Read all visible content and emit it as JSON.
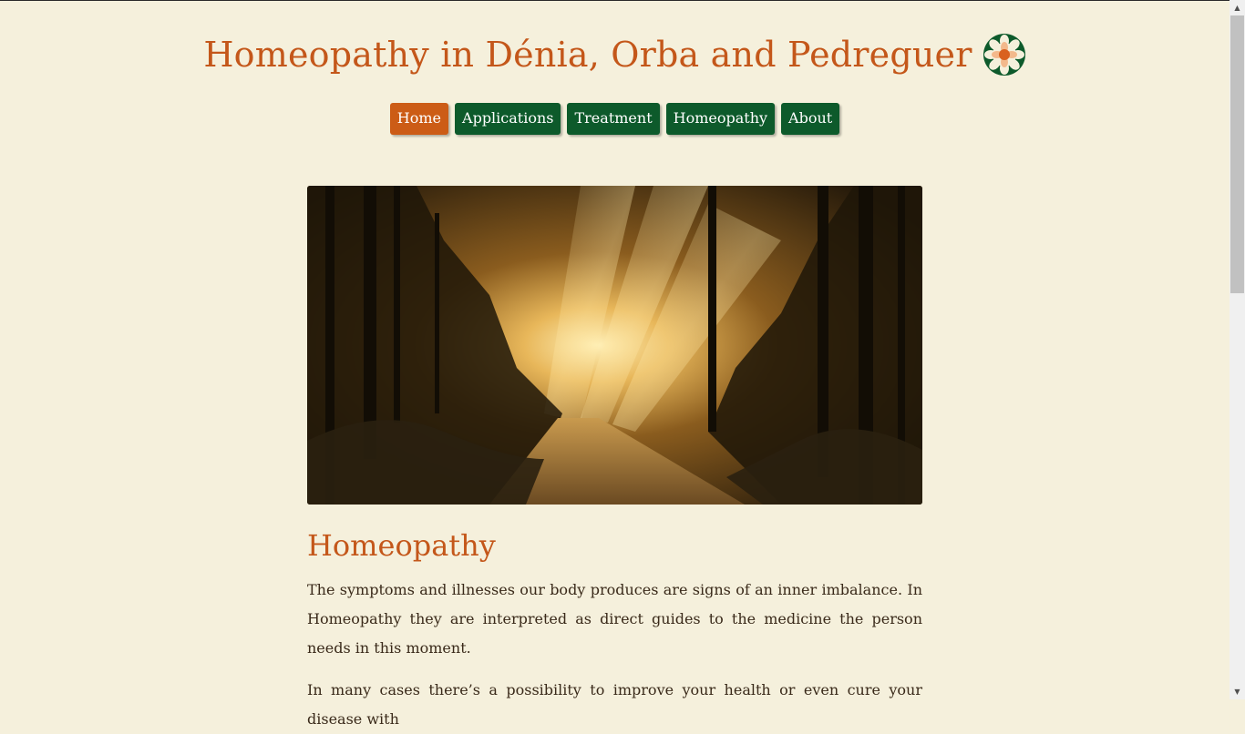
{
  "site": {
    "title": "Homeopathy in Dénia, Orba and Pedreguer",
    "logo_icon": "flower-mandala-icon"
  },
  "nav": {
    "items": [
      {
        "label": "Home",
        "active": true
      },
      {
        "label": "Applications",
        "active": false
      },
      {
        "label": "Treatment",
        "active": false
      },
      {
        "label": "Homeopathy",
        "active": false
      },
      {
        "label": "About",
        "active": false
      }
    ]
  },
  "hero": {
    "description": "sunlit forest path"
  },
  "content": {
    "heading": "Homeopathy",
    "paragraphs": [
      "The symptoms and illnesses our body produces are signs of an inner imbalance. In Homeopathy they are interpreted as direct guides to the medicine the person needs in this moment.",
      "In many cases there’s a possibility to improve your health or even cure your disease with"
    ]
  },
  "colors": {
    "background": "#f5f0dc",
    "accent": "#c4571a",
    "nav_green": "#0d5a2b",
    "nav_active": "#cc5c16"
  },
  "scrollbar": {
    "up_icon": "scroll-up-arrow-icon",
    "down_icon": "scroll-down-arrow-icon"
  }
}
